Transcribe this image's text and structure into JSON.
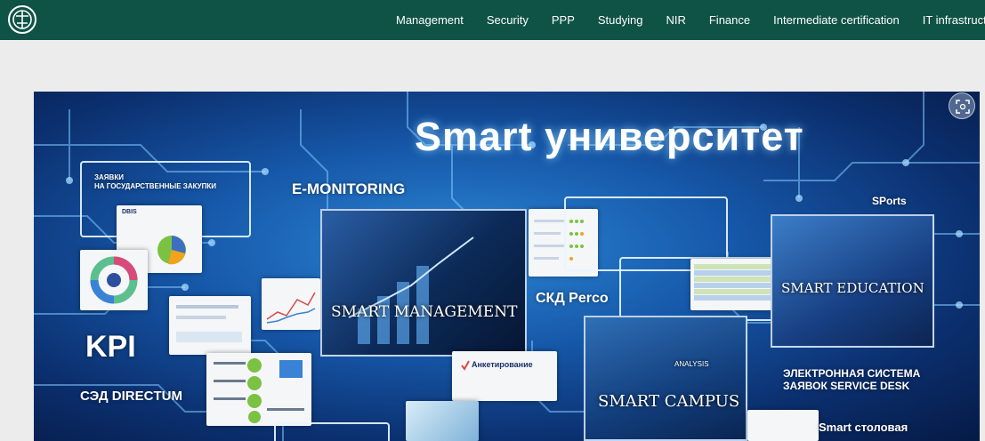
{
  "navbar": {
    "logo_icon": "university-shield-logo-icon",
    "items": [
      {
        "label": "Management"
      },
      {
        "label": "Security"
      },
      {
        "label": "PPP"
      },
      {
        "label": "Studying"
      },
      {
        "label": "NIR"
      },
      {
        "label": "Finance"
      },
      {
        "label": "Intermediate certification"
      },
      {
        "label": "IT infrastructu"
      }
    ]
  },
  "banner": {
    "title": "Smart университет",
    "labels": {
      "procurement": "ЗАЯВКИ\nНА ГОСУДАРСТВЕННЫЕ ЗАКУПКИ",
      "e_monitoring": "E-MONITORING",
      "sports": "SPorts",
      "kpi": "KPI",
      "sed_directum": "СЭД DIRECTUM",
      "ska_perco": "СКД Perco",
      "service_desk": "ЭЛЕКТРОННАЯ СИСТЕМА\nЗАЯВОК SERVICE DESK",
      "smart_canteen": "Smart столовая",
      "smart_management": "SMART MANAGEMENT",
      "smart_education": "SMART EDUCATION",
      "smart_campus": "SMART CAMPUS",
      "analysis": "ANALYSIS",
      "survey": "Анкетирование",
      "dbis": "DBIS"
    },
    "zoom_icon": "focus-zoom-icon",
    "colors": {
      "navbar_bg": "#0f5246",
      "banner_blue": "#1657a8",
      "accent_green": "#7cc242"
    }
  }
}
